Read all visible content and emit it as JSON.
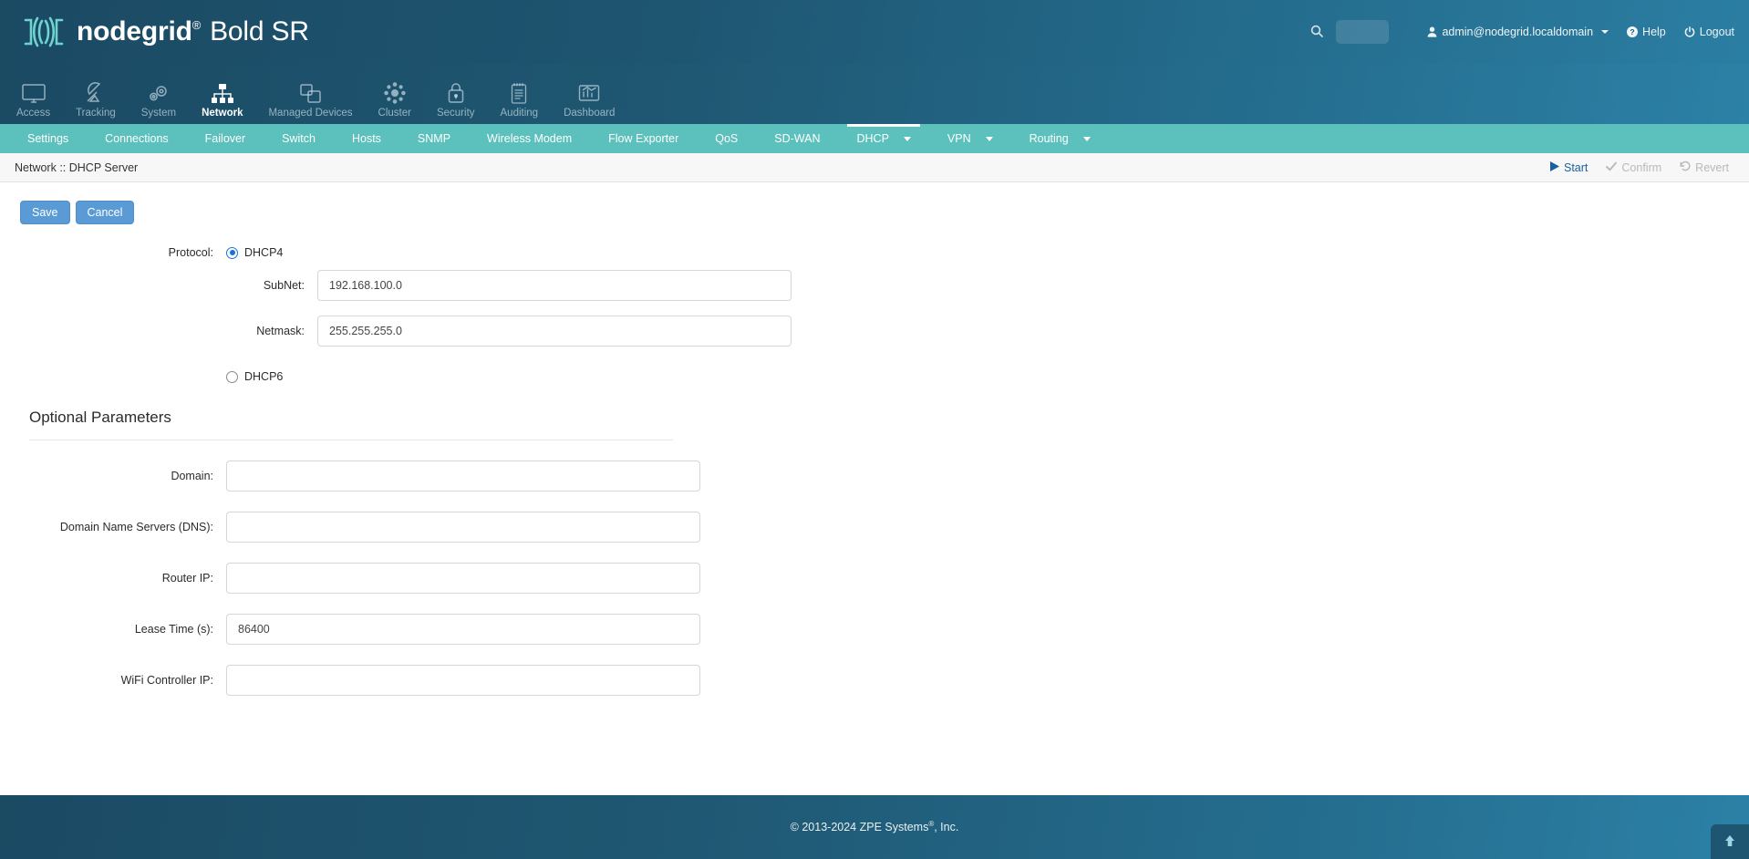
{
  "brand": {
    "name": "nodegrid",
    "registered": "®",
    "model": "Bold SR",
    "logo_icon": "nodegrid-logo-icon"
  },
  "header": {
    "search_icon": "search-icon",
    "search_placeholder": "",
    "search_value": "",
    "user": {
      "icon": "user-icon",
      "label": "admin@nodegrid.localdomain"
    },
    "help": {
      "icon": "help-circle-icon",
      "label": "Help"
    },
    "logout": {
      "icon": "power-icon",
      "label": "Logout"
    }
  },
  "mainnav": {
    "items": [
      {
        "label": "Access",
        "icon": "monitor-icon",
        "active": false
      },
      {
        "label": "Tracking",
        "icon": "satellite-dish-icon",
        "active": false
      },
      {
        "label": "System",
        "icon": "gears-icon",
        "active": false
      },
      {
        "label": "Network",
        "icon": "network-tree-icon",
        "active": true
      },
      {
        "label": "Managed Devices",
        "icon": "windows-stack-icon",
        "active": false
      },
      {
        "label": "Cluster",
        "icon": "cluster-nodes-icon",
        "active": false
      },
      {
        "label": "Security",
        "icon": "padlock-icon",
        "active": false
      },
      {
        "label": "Auditing",
        "icon": "notepad-icon",
        "active": false
      },
      {
        "label": "Dashboard",
        "icon": "chart-board-icon",
        "active": false
      }
    ]
  },
  "subnav": {
    "items": [
      {
        "label": "Settings",
        "active": false,
        "dropdown": false
      },
      {
        "label": "Connections",
        "active": false,
        "dropdown": false
      },
      {
        "label": "Failover",
        "active": false,
        "dropdown": false
      },
      {
        "label": "Switch",
        "active": false,
        "dropdown": false
      },
      {
        "label": "Hosts",
        "active": false,
        "dropdown": false
      },
      {
        "label": "SNMP",
        "active": false,
        "dropdown": false
      },
      {
        "label": "Wireless Modem",
        "active": false,
        "dropdown": false
      },
      {
        "label": "Flow Exporter",
        "active": false,
        "dropdown": false
      },
      {
        "label": "QoS",
        "active": false,
        "dropdown": false
      },
      {
        "label": "SD-WAN",
        "active": false,
        "dropdown": false
      },
      {
        "label": "DHCP",
        "active": true,
        "dropdown": true
      },
      {
        "label": "VPN",
        "active": false,
        "dropdown": true
      },
      {
        "label": "Routing",
        "active": false,
        "dropdown": true
      }
    ]
  },
  "breadcrumb": {
    "text": "Network :: DHCP Server",
    "actions": [
      {
        "label": "Start",
        "icon": "play-icon",
        "enabled": true
      },
      {
        "label": "Confirm",
        "icon": "check-icon",
        "enabled": false
      },
      {
        "label": "Revert",
        "icon": "revert-icon",
        "enabled": false
      }
    ]
  },
  "toolbar": {
    "save_label": "Save",
    "cancel_label": "Cancel"
  },
  "form": {
    "protocol_label": "Protocol:",
    "protocol_options": [
      {
        "label": "DHCP4",
        "selected": true
      },
      {
        "label": "DHCP6",
        "selected": false
      }
    ],
    "fields": [
      {
        "label": "SubNet:",
        "value": "192.168.100.0",
        "placeholder": ""
      },
      {
        "label": "Netmask:",
        "value": "255.255.255.0",
        "placeholder": ""
      }
    ]
  },
  "optional": {
    "section_title": "Optional Parameters",
    "fields": [
      {
        "label": "Domain:",
        "value": "",
        "placeholder": ""
      },
      {
        "label": "Domain Name Servers (DNS):",
        "value": "",
        "placeholder": ""
      },
      {
        "label": "Router IP:",
        "value": "",
        "placeholder": ""
      },
      {
        "label": "Lease Time (s):",
        "value": "86400",
        "placeholder": ""
      },
      {
        "label": "WiFi Controller IP:",
        "value": "",
        "placeholder": ""
      }
    ]
  },
  "footer": {
    "copyright_pre": "© 2013-2024 ZPE Systems",
    "copyright_sup": "®",
    "copyright_post": ", Inc.",
    "to_top_icon": "arrow-up-icon"
  },
  "colors": {
    "header_dark": "#1b4a63",
    "header_light": "#2c81a6",
    "subnav": "#5cc0bd",
    "button_blue": "#5b9bd5",
    "link_blue": "#1a5f9e",
    "radio_blue": "#1b72d8",
    "disabled_grey": "#b9b9b9"
  }
}
